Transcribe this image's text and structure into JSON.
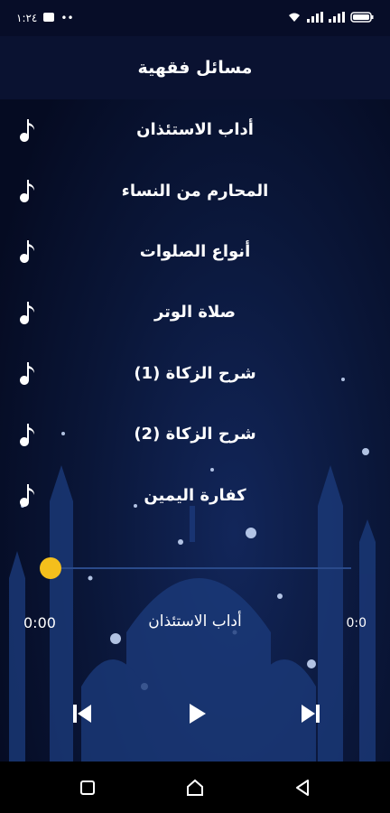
{
  "status": {
    "time": "١:٢٤",
    "dots": "••"
  },
  "header": {
    "title": "مسائل فقهية"
  },
  "tracks": [
    {
      "title": "أداب الاستئذان",
      "icon": "music-note-icon"
    },
    {
      "title": "المحارم من النساء",
      "icon": "music-note-icon"
    },
    {
      "title": "أنواع الصلوات",
      "icon": "music-note-icon"
    },
    {
      "title": "صلاة الوتر",
      "icon": "music-note-icon"
    },
    {
      "title": "شرح الزكاة (1)",
      "icon": "music-note-icon"
    },
    {
      "title": "شرح الزكاة (2)",
      "icon": "music-note-icon"
    },
    {
      "title": "كفارة اليمين",
      "icon": "music-note-icon"
    }
  ],
  "player": {
    "current_time": "0:00",
    "duration": "0:0",
    "now_playing": "أداب الاستئذان",
    "progress": 0
  },
  "colors": {
    "accent": "#f4bf1c",
    "background": "#050b22",
    "appbar": "#0a1231"
  }
}
